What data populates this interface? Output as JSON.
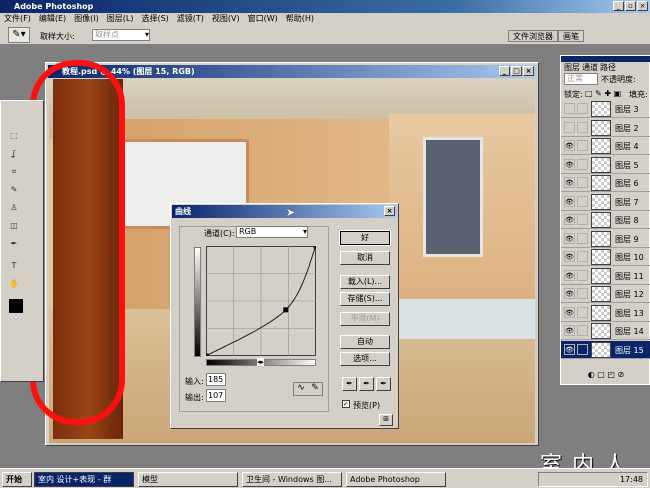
{
  "app": {
    "title": "Adobe Photoshop"
  },
  "menu": [
    "文件(F)",
    "编辑(E)",
    "图像(I)",
    "图层(L)",
    "选择(S)",
    "滤镜(T)",
    "视图(V)",
    "窗口(W)",
    "帮助(H)"
  ],
  "options": {
    "sample_label": "取样大小:",
    "sample_value": "取样点",
    "tabs": [
      "文件浏览器",
      "画笔"
    ]
  },
  "document": {
    "title": "教程.psd @ 44% (图层 15, RGB)"
  },
  "layers_panel": {
    "tabs": [
      "图层",
      "通道",
      "路径"
    ],
    "blend_mode": "正常",
    "opacity_label": "不透明度:",
    "lock_label": "锁定:",
    "fill_label": "填充:",
    "layers": [
      {
        "name": "图层 3",
        "visible": false
      },
      {
        "name": "图层 2",
        "visible": false
      },
      {
        "name": "图层 4",
        "visible": true
      },
      {
        "name": "图层 5",
        "visible": true
      },
      {
        "name": "图层 6",
        "visible": true
      },
      {
        "name": "图层 7",
        "visible": true
      },
      {
        "name": "图层 8",
        "visible": true
      },
      {
        "name": "图层 9",
        "visible": true
      },
      {
        "name": "图层 10",
        "visible": true
      },
      {
        "name": "图层 11",
        "visible": true
      },
      {
        "name": "图层 12",
        "visible": true
      },
      {
        "name": "图层 13",
        "visible": true
      },
      {
        "name": "图层 14",
        "visible": true
      },
      {
        "name": "图层 15",
        "visible": true,
        "selected": true
      }
    ]
  },
  "curves": {
    "title": "曲线",
    "channel_label": "通道(C):",
    "channel": "RGB",
    "ok": "好",
    "cancel": "取消",
    "load": "载入(L)...",
    "save": "存储(S)...",
    "smooth": "平滑(M)",
    "auto": "自动",
    "options": "选项...",
    "input_label": "输入:",
    "input": "185",
    "output_label": "输出:",
    "output": "107",
    "preview_label": "预览(P)",
    "preview": true,
    "points": [
      [
        0,
        0
      ],
      [
        185,
        107
      ],
      [
        255,
        255
      ]
    ]
  },
  "taskbar": {
    "start": "开始",
    "items": [
      "室内 设计+表现 - 群",
      "模型",
      "卫生间 - Windows 图...",
      "Adobe Photoshop"
    ],
    "clock": "17:48"
  },
  "watermark": "室内人"
}
